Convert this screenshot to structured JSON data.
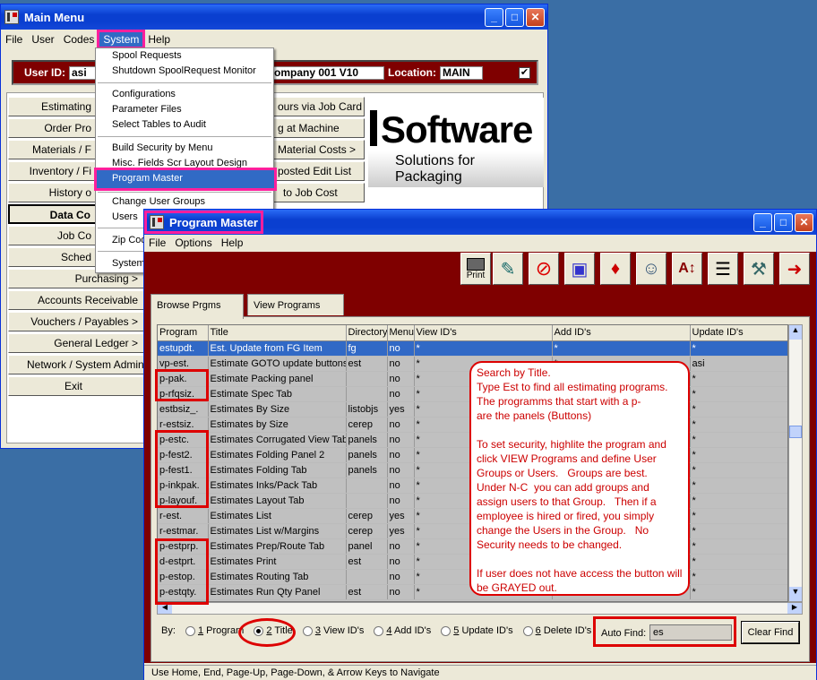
{
  "main_menu": {
    "title": "Main Menu",
    "menus": [
      "File",
      "User",
      "Codes",
      "System",
      "Help"
    ],
    "user_id_label": "User ID:",
    "user_id": "asi",
    "company": "ompany 001 V10",
    "location_label": "Location:",
    "location": "MAIN",
    "buttons": [
      "Estimating",
      "Order Pro",
      "Materials / F",
      "Inventory / Fi",
      "History o",
      "Data Co",
      "Job Co",
      "Sched",
      "Purchasing >",
      "Accounts Receivable",
      "Vouchers / Payables >",
      "General Ledger >",
      "Network / System Administ",
      "Exit"
    ],
    "right_buttons": [
      "ours via Job Card",
      "g at Machine",
      "Material Costs >",
      "posted Edit List",
      "to Job Cost"
    ],
    "logo_text": "Software",
    "logo_sub": "Solutions for Packaging"
  },
  "system_menu": {
    "items": [
      "Spool Requests",
      "Shutdown SpoolRequest Monitor",
      "Configurations",
      "Parameter Files",
      "Select Tables to Audit",
      "Build Security by Menu",
      "Misc. Fields Scr Layout Design",
      "Program Master",
      "Change User Groups",
      "Users",
      "Zip Cod",
      "System"
    ]
  },
  "program_master": {
    "title": "Program Master",
    "menus": [
      "File",
      "Options",
      "Help"
    ],
    "print_label": "Print",
    "tabs": [
      "Browse Prgms",
      "View Programs"
    ],
    "columns": [
      "Program",
      "Title",
      "Directory",
      "Menu",
      "View ID's",
      "Add ID's",
      "Update ID's"
    ],
    "rows": [
      [
        "estupdt.",
        "Est. Update from FG Item",
        "fg",
        "no",
        "*",
        "*",
        "*"
      ],
      [
        "vp-est.",
        "Estimate GOTO update buttons",
        "est",
        "no",
        "*",
        "*",
        "asi"
      ],
      [
        "p-pak.",
        "Estimate Packing panel",
        "",
        "no",
        "*",
        "*",
        "*"
      ],
      [
        "p-rfqsiz.",
        "Estimate Spec Tab",
        "",
        "no",
        "*",
        "*",
        "*"
      ],
      [
        "estbsiz_.",
        "Estimates By Size",
        "listobjs",
        "yes",
        "*",
        "*",
        "*"
      ],
      [
        "r-estsiz.",
        "Estimates by Size",
        "cerep",
        "no",
        "*",
        "*",
        "*"
      ],
      [
        "p-estc.",
        "Estimates Corrugated View Tab",
        "panels",
        "no",
        "*",
        "*",
        "*"
      ],
      [
        "p-fest2.",
        "Estimates Folding Panel 2",
        "panels",
        "no",
        "*",
        "*",
        "*"
      ],
      [
        "p-fest1.",
        "Estimates Folding Tab",
        "panels",
        "no",
        "*",
        "*",
        "*"
      ],
      [
        "p-inkpak.",
        "Estimates Inks/Pack Tab",
        "",
        "no",
        "*",
        "*",
        "*"
      ],
      [
        "p-layouf.",
        "Estimates Layout Tab",
        "",
        "no",
        "*",
        "*",
        "*"
      ],
      [
        "r-est.",
        "Estimates List",
        "cerep",
        "yes",
        "*",
        "*",
        "*"
      ],
      [
        "r-estmar.",
        "Estimates List w/Margins",
        "cerep",
        "yes",
        "*",
        "*",
        "*"
      ],
      [
        "p-estprp.",
        "Estimates Prep/Route Tab",
        "panel",
        "no",
        "*",
        "*",
        "*"
      ],
      [
        "d-estprt.",
        "Estimates Print",
        "est",
        "no",
        "*",
        "*",
        "*"
      ],
      [
        "p-estop.",
        "Estimates Routing Tab",
        "",
        "no",
        "*",
        "*",
        "*"
      ],
      [
        "p-estqty.",
        "Estimates Run Qty Panel",
        "est",
        "no",
        "*",
        "*",
        "*"
      ]
    ],
    "by_label": "By:",
    "sort_options": [
      {
        "num": "1",
        "label": "Program"
      },
      {
        "num": "2",
        "label": "Title"
      },
      {
        "num": "3",
        "label": "View ID's"
      },
      {
        "num": "4",
        "label": "Add ID's"
      },
      {
        "num": "5",
        "label": "Update ID's"
      },
      {
        "num": "6",
        "label": "Delete ID's"
      }
    ],
    "auto_find_label": "Auto Find:",
    "auto_find_value": "es",
    "clear_find": "Clear Find",
    "status": "Use Home, End, Page-Up, Page-Down, & Arrow Keys to Navigate"
  },
  "annotation": "Search by Title.\nType Est to find all estimating programs.\nThe programms that start with a p-\nare the panels (Buttons)\n\nTo set security, highlite the program and click VIEW Programs and define User Groups or Users.   Groups are best.  Under N-C  you can add groups and assign users to that Group.   Then if a employee is hired or fired, you simply change the Users in the Group.   No Security needs to be changed.\n\nIf user does not have access the button will be GRAYED out.",
  "colors": {
    "highlight_magenta": "#ff1f9c",
    "annotation_red": "#d00000",
    "band": "#7f0000",
    "selection": "#3169c6"
  }
}
